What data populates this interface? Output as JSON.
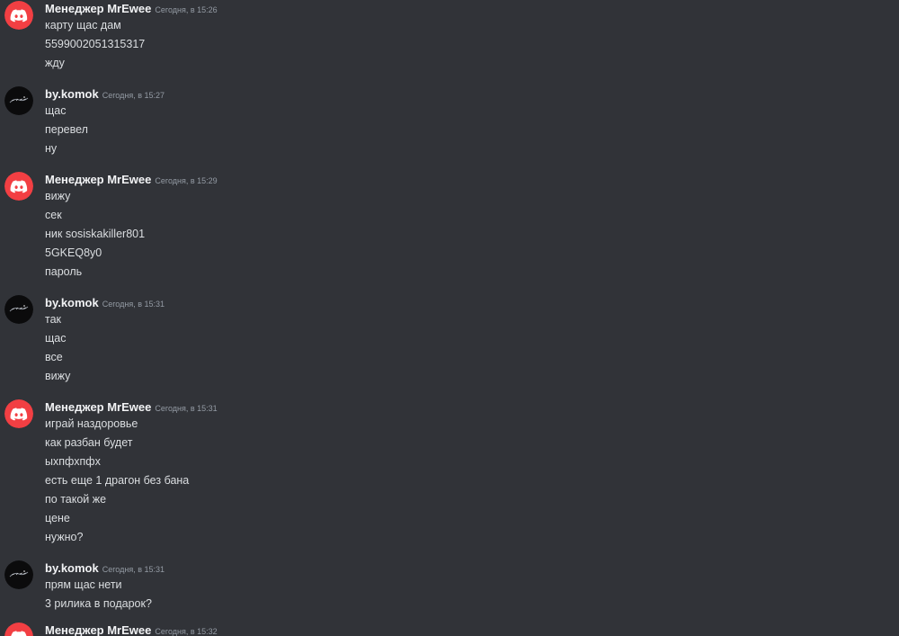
{
  "messages": [
    {
      "author": "Менеджер MrEwee",
      "avatar_icon": "discord-logo-icon",
      "time": "Сегодня, в 15:26",
      "lines": [
        "карту щас дам",
        "5599002051315317",
        "жду"
      ]
    },
    {
      "author": "by.komok",
      "avatar_icon": "user-avatar-icon",
      "time": "Сегодня, в 15:27",
      "lines": [
        "щас",
        "перевел",
        "ну"
      ]
    },
    {
      "author": "Менеджер MrEwee",
      "avatar_icon": "discord-logo-icon",
      "time": "Сегодня, в 15:29",
      "lines": [
        "вижу",
        "сек",
        "ник sosiskakiller801",
        "5GKEQ8y0",
        "пароль"
      ]
    },
    {
      "author": "by.komok",
      "avatar_icon": "user-avatar-icon",
      "time": "Сегодня, в 15:31",
      "lines": [
        "так",
        "щас",
        "все",
        "вижу"
      ]
    },
    {
      "author": "Менеджер MrEwee",
      "avatar_icon": "discord-logo-icon",
      "time": "Сегодня, в 15:31",
      "lines": [
        "играй наздоровье",
        "как разбан будет",
        "ыхпфхпфх",
        "есть еще 1 драгон без бана",
        "по такой же",
        "цене",
        "нужно?"
      ]
    },
    {
      "author": "by.komok",
      "avatar_icon": "user-avatar-icon",
      "time": "Сегодня, в 15:31",
      "lines": [
        "прям щас нети",
        "3 рилика в подарок?"
      ]
    },
    {
      "author": "Менеджер MrEwee",
      "avatar_icon": "discord-logo-icon",
      "time": "Сегодня, в 15:32",
      "lines": []
    }
  ],
  "colors": {
    "background": "#313338",
    "discord_avatar_bg": "#f23f43",
    "author_text": "#f2f3f5",
    "timestamp_text": "#949ba4",
    "message_text": "#dbdee1"
  }
}
